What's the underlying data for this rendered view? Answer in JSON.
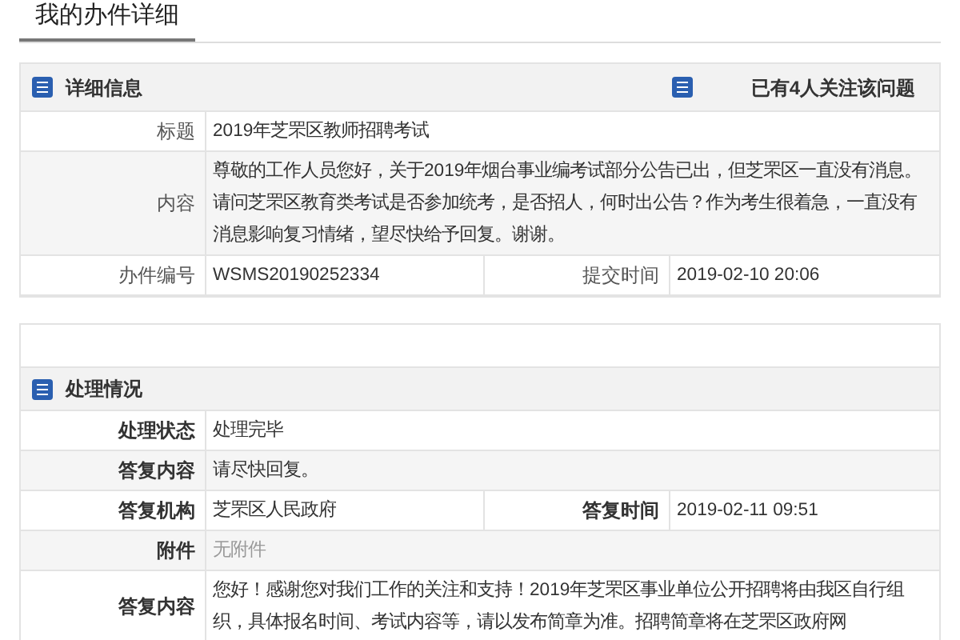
{
  "page_tab": {
    "label": "我的办件详细"
  },
  "detail": {
    "title": "详细信息",
    "followers": "已有4人关注该问题",
    "rows": [
      {
        "kind": "single",
        "label": "标题",
        "value": "2019年芝罘区教师招聘考试"
      },
      {
        "kind": "single",
        "label": "内容",
        "value": "尊敬的工作人员您好，关于2019年烟台事业编考试部分公告已出，但芝罘区一直没有消息。请问芝罘区教育类考试是否参加统考，是否招人，何时出公告？作为考生很着急，一直没有消息影响复习情绪，望尽快给予回复。谢谢。"
      },
      {
        "kind": "pair",
        "label": "办件编号",
        "value": "WSMS20190252334",
        "label2": "提交时间",
        "value2": "2019-02-10 20:06"
      }
    ]
  },
  "processing": {
    "title": "处理情况",
    "rows": [
      {
        "kind": "single",
        "label": "处理状态",
        "value": "处理完毕"
      },
      {
        "kind": "single",
        "label": "答复内容",
        "value": "请尽快回复。"
      },
      {
        "kind": "pair",
        "label": "答复机构",
        "value": "芝罘区人民政府",
        "label2": "答复时间",
        "value2": "2019-02-11 09:51"
      },
      {
        "kind": "single",
        "label": "附件",
        "value": "无附件",
        "muted": true
      },
      {
        "kind": "single",
        "label": "答复内容",
        "value": "您好！感谢您对我们工作的关注和支持！2019年芝罘区事业单位公开招聘将由我区自行组织，具体报名时间、考试内容等，请以发布简章为准。招聘简章将在芝罘区政府网"
      }
    ]
  }
}
